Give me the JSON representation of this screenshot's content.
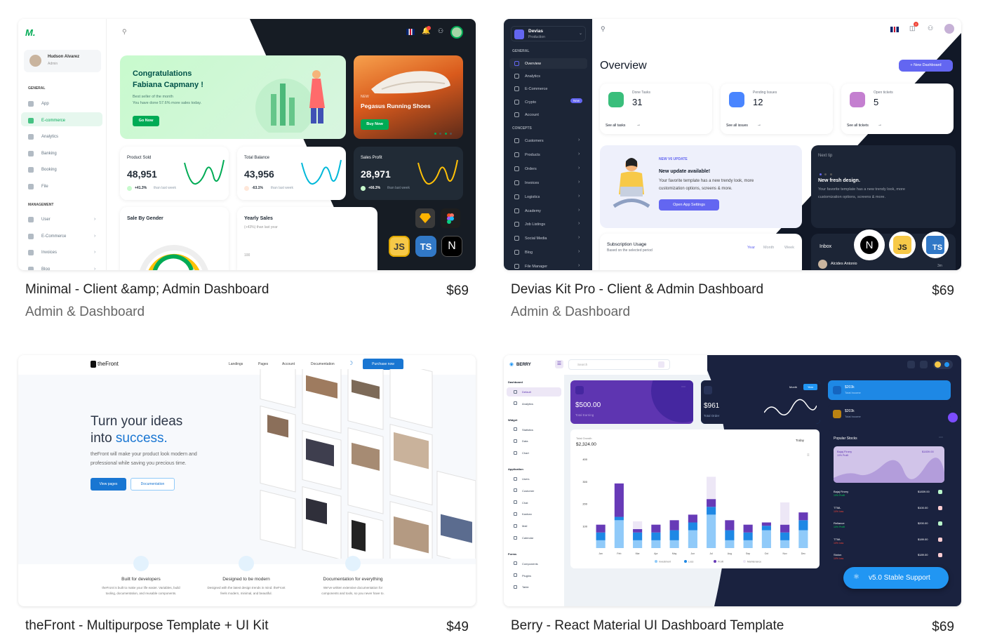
{
  "products": [
    {
      "title": "Minimal - Client &amp; Admin Dashboard",
      "price": "$69",
      "category": "Admin & Dashboard"
    },
    {
      "title": "Devias Kit Pro - Client & Admin Dashboard",
      "price": "$69",
      "category": "Admin & Dashboard"
    },
    {
      "title": "theFront - Multipurpose Template + UI Kit",
      "price": "$49",
      "category": ""
    },
    {
      "title": "Berry - React Material UI Dashboard Template",
      "price": "$69",
      "category": ""
    }
  ],
  "minimal": {
    "user": "Hudson Alvarez",
    "role": "Admin",
    "sections": [
      "GENERAL",
      "MANAGEMENT"
    ],
    "nav_general": [
      "App",
      "E-commerce",
      "Analytics",
      "Banking",
      "Booking",
      "File"
    ],
    "nav_management": [
      "User",
      "E-Commerce",
      "Invoices",
      "Blog"
    ],
    "welcome_title": "Congratulations",
    "welcome_name": "Fabiana Capmany !",
    "welcome_sub1": "Best seller of the month",
    "welcome_sub2": "You have done 57.6% more sales today.",
    "go_now": "Go Now",
    "promo_tag": "NEW",
    "promo_title": "Pegasus Running Shoes",
    "buy_now": "Buy Now",
    "stats": [
      {
        "label": "Product Sold",
        "value": "48,951",
        "change": "+41.3%",
        "note": "than last week"
      },
      {
        "label": "Total Balance",
        "value": "43,956",
        "change": "-63.1%",
        "note": "than last week"
      },
      {
        "label": "Sales Profit",
        "value": "28,971",
        "change": "+66.3%",
        "note": "than last week"
      }
    ],
    "gender": "Sale By Gender",
    "yearly": "Yearly Sales",
    "yearly_sub": "(+43%) than last year",
    "axis_100": "100",
    "badges": [
      "JS",
      "TS",
      "N"
    ]
  },
  "devias": {
    "company": "Devias",
    "env": "Production",
    "section_general": "GENERAL",
    "section_concepts": "CONCEPTS",
    "nav_general": [
      "Overview",
      "Analytics",
      "E-Commerce",
      "Crypto",
      "Account"
    ],
    "new_badge": "New",
    "nav_concepts": [
      "Customers",
      "Products",
      "Orders",
      "Invoices",
      "Logistics",
      "Academy",
      "Job Listings",
      "Social Media",
      "Blog",
      "File Manager"
    ],
    "notif_count": "2",
    "heading": "Overview",
    "new_dashboard": "+ New Dashboard",
    "stats": [
      {
        "label": "Done Tasks",
        "value": "31",
        "link": "See all tasks"
      },
      {
        "label": "Pending Issues",
        "value": "12",
        "link": "See all issues"
      },
      {
        "label": "Open tickets",
        "value": "5",
        "link": "See all tickets"
      }
    ],
    "update_tag": "NEW V6 UPDATE",
    "update_title": "New update available!",
    "update_desc1": "Your favorite template has a new trendy look, more",
    "update_desc2": "customization options, screens & more.",
    "open_settings": "Open App Settings",
    "fresh_title": "New fresh design.",
    "fresh_desc1": "Your favorite template has a new trendy look, more",
    "fresh_desc2": "customization options, screens & more.",
    "hint": "Next tip",
    "sub_title": "Subscription Usage",
    "sub_desc": "Based on the selected period",
    "periods": [
      "Year",
      "Month",
      "Week"
    ],
    "inbox": "Inbox",
    "sender": "Alcides Antonio",
    "time": "3m",
    "badges": [
      "N",
      "JS",
      "TS"
    ]
  },
  "thefront": {
    "brand": "theFront",
    "nav": [
      "Landings",
      "Pages",
      "Account",
      "Documentation"
    ],
    "purchase": "Purchase now",
    "hero1": "Turn your ideas",
    "hero2a": "into ",
    "hero2b": "success.",
    "desc1": "theFront will make your product look modern and",
    "desc2": "professional while saving you precious time.",
    "btn_primary": "View pages",
    "btn_secondary": "Documentation",
    "features": [
      {
        "title": "Built for developers",
        "d1": "theFront is built to make your life easier. Variables, build",
        "d2": "tooling, documentation, and reusable components."
      },
      {
        "title": "Designed to be modern",
        "d1": "Designed with the latest design trends in mind. theFront",
        "d2": "feels modern, minimal, and beautiful."
      },
      {
        "title": "Documentation for everything",
        "d1": "We've written extensive documentation for",
        "d2": "components and tools, so you never have to."
      }
    ]
  },
  "berry": {
    "brand": "BERRY",
    "search": "Search",
    "groups": [
      {
        "label": "Dashboard",
        "items": [
          "Default",
          "Analytics"
        ]
      },
      {
        "label": "Widget",
        "items": [
          "Statistics",
          "Data",
          "Chart"
        ]
      },
      {
        "label": "Application",
        "items": [
          "Users",
          "Customer",
          "Chat",
          "Kanban",
          "Mail",
          "Calendar"
        ]
      },
      {
        "label": "Forms",
        "items": [
          "Components",
          "Plugins",
          "Table"
        ]
      }
    ],
    "earning_value": "$500.00",
    "earning_label": "Total Earning",
    "order_value": "$961",
    "order_label": "Total Order",
    "toggle_month": "Month",
    "toggle_year": "Year",
    "income1_value": "$203k",
    "income1_label": "Total Income",
    "income2_value": "$203k",
    "income2_label": "Total Income",
    "growth_label": "Total Growth",
    "growth_value": "$2,324.00",
    "today": "Today",
    "legend": [
      "Investment",
      "Loss",
      "Profit",
      "Maintenance"
    ],
    "stocks_title": "Popular Stocks",
    "stock_name": "Bajaj Finery",
    "stock_value": "$1839.00",
    "stock_sub": "10% Profit",
    "stocks": [
      {
        "name": "Bajaj Finery",
        "value": "$1839.00",
        "sub": "10% Profit"
      },
      {
        "name": "TTML",
        "value": "$100.00",
        "sub": "10% loss"
      },
      {
        "name": "Reliance",
        "value": "$200.00",
        "sub": "10% Profit"
      },
      {
        "name": "TTML",
        "value": "$189.00",
        "sub": "10% loss"
      },
      {
        "name": "Stolon",
        "value": "$189.00",
        "sub": "10% loss"
      }
    ],
    "support": "v5.0 Stable Support"
  },
  "chart_data": {
    "type": "bar",
    "title": "",
    "categories": [
      "Jan",
      "Feb",
      "Mar",
      "Apr",
      "May",
      "Jun",
      "Jul",
      "Aug",
      "Sep",
      "Oct",
      "Nov",
      "Dec"
    ],
    "series": [
      {
        "name": "Investment",
        "values": [
          35,
          125,
          35,
          35,
          35,
          80,
          150,
          35,
          35,
          80,
          35,
          80
        ]
      },
      {
        "name": "Loss",
        "values": [
          35,
          15,
          35,
          35,
          45,
          35,
          35,
          45,
          35,
          20,
          35,
          45
        ]
      },
      {
        "name": "Profit",
        "values": [
          35,
          150,
          15,
          35,
          45,
          35,
          35,
          45,
          35,
          15,
          35,
          35
        ]
      },
      {
        "name": "Maintenance",
        "values": [
          0,
          0,
          35,
          0,
          0,
          0,
          100,
          0,
          0,
          0,
          100,
          0
        ]
      }
    ],
    "ylim": [
      0,
      400
    ],
    "yticks": [
      "400",
      "300",
      "200",
      "100"
    ]
  },
  "colors": {
    "green": "#00ab55",
    "devias": "#6366f1",
    "berry": "#5e35b1",
    "blue": "#2196f3",
    "thefront": "#1976d2"
  }
}
